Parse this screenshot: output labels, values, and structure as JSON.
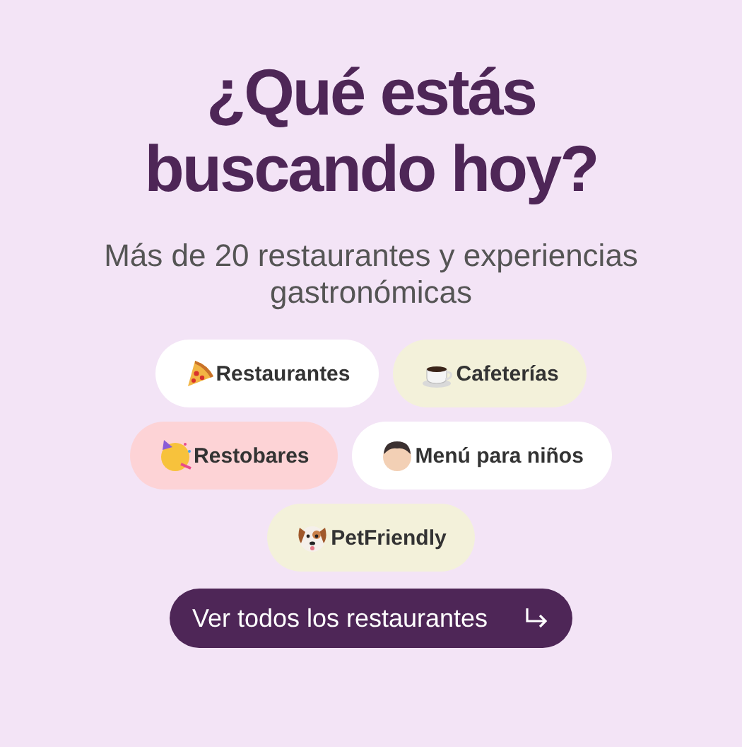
{
  "heading": "¿Qué estás buscando hoy?",
  "subtitle": "Más de 20 restaurantes y experiencias gastronómicas",
  "categories": [
    {
      "label": "Restaurantes",
      "kind": "pizza",
      "color": "#ffffff"
    },
    {
      "label": "Cafeterías",
      "kind": "coffee",
      "color": "#f3f1da"
    },
    {
      "label": "Restobares",
      "kind": "party",
      "color": "#fdd3d6"
    },
    {
      "label": "Menú para niños",
      "kind": "child",
      "color": "#ffffff"
    },
    {
      "label": "PetFriendly",
      "kind": "dog",
      "color": "#f3f1da"
    }
  ],
  "cta": {
    "label": "Ver todos los restaurantes"
  }
}
